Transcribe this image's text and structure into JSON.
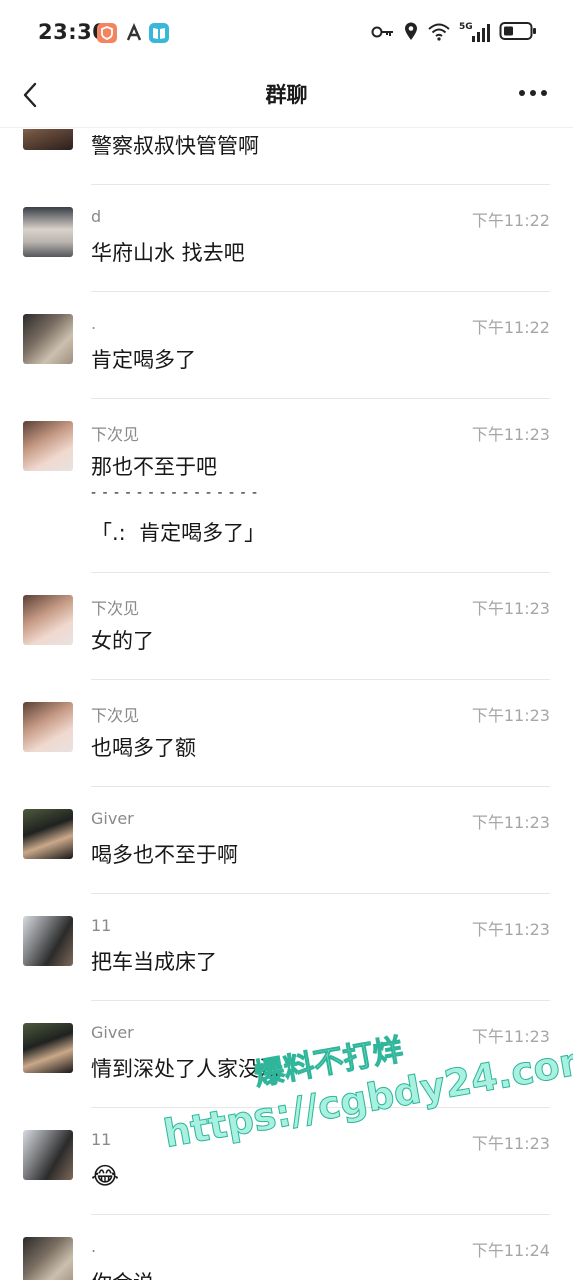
{
  "status_bar": {
    "time": "23:30",
    "network": "5G",
    "icons": [
      "shield-app-icon",
      "a-app-icon",
      "book-app-icon",
      "key-icon",
      "location-icon",
      "wifi-icon",
      "signal-icon",
      "battery-icon"
    ]
  },
  "header": {
    "title": "群聊",
    "back_icon": "chevron-left-icon",
    "more_icon": "more-dots-icon"
  },
  "messages": [
    {
      "sender": "",
      "time": "",
      "body": "警察叔叔快管管啊"
    },
    {
      "sender": "d",
      "time": "下午11:22",
      "body": "华府山水 找去吧"
    },
    {
      "sender": ".",
      "time": "下午11:22",
      "body": "肯定喝多了"
    },
    {
      "sender": "下次见",
      "time": "下午11:23",
      "body": "那也不至于吧",
      "quote_separator": "- - - - - - - - - - - - - - -",
      "quote": "「.:  肯定喝多了」"
    },
    {
      "sender": "下次见",
      "time": "下午11:23",
      "body": "女的了"
    },
    {
      "sender": "下次见",
      "time": "下午11:23",
      "body": "也喝多了额"
    },
    {
      "sender": "Giver",
      "time": "下午11:23",
      "body": "喝多也不至于啊"
    },
    {
      "sender": "11",
      "time": "下午11:23",
      "body": "把车当成床了"
    },
    {
      "sender": "Giver",
      "time": "下午11:23",
      "body": "情到深处了人家没法"
    },
    {
      "sender": "11",
      "time": "下午11:23",
      "body": "😂"
    },
    {
      "sender": ".",
      "time": "下午11:24",
      "body": "你会说"
    }
  ],
  "watermark": {
    "line1": "爆料不打烊",
    "line2": "https://cgbdy24.com"
  },
  "colors": {
    "watermark_fill": "#a8f0e0",
    "watermark_stroke": "#2fb59a",
    "divider": "#e6e6e6"
  }
}
